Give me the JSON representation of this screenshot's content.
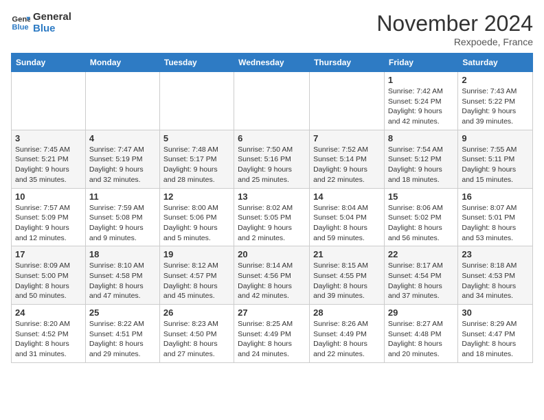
{
  "logo": {
    "line1": "General",
    "line2": "Blue"
  },
  "title": "November 2024",
  "location": "Rexpoede, France",
  "days_of_week": [
    "Sunday",
    "Monday",
    "Tuesday",
    "Wednesday",
    "Thursday",
    "Friday",
    "Saturday"
  ],
  "weeks": [
    [
      {
        "day": "",
        "info": ""
      },
      {
        "day": "",
        "info": ""
      },
      {
        "day": "",
        "info": ""
      },
      {
        "day": "",
        "info": ""
      },
      {
        "day": "",
        "info": ""
      },
      {
        "day": "1",
        "info": "Sunrise: 7:42 AM\nSunset: 5:24 PM\nDaylight: 9 hours and 42 minutes."
      },
      {
        "day": "2",
        "info": "Sunrise: 7:43 AM\nSunset: 5:22 PM\nDaylight: 9 hours and 39 minutes."
      }
    ],
    [
      {
        "day": "3",
        "info": "Sunrise: 7:45 AM\nSunset: 5:21 PM\nDaylight: 9 hours and 35 minutes."
      },
      {
        "day": "4",
        "info": "Sunrise: 7:47 AM\nSunset: 5:19 PM\nDaylight: 9 hours and 32 minutes."
      },
      {
        "day": "5",
        "info": "Sunrise: 7:48 AM\nSunset: 5:17 PM\nDaylight: 9 hours and 28 minutes."
      },
      {
        "day": "6",
        "info": "Sunrise: 7:50 AM\nSunset: 5:16 PM\nDaylight: 9 hours and 25 minutes."
      },
      {
        "day": "7",
        "info": "Sunrise: 7:52 AM\nSunset: 5:14 PM\nDaylight: 9 hours and 22 minutes."
      },
      {
        "day": "8",
        "info": "Sunrise: 7:54 AM\nSunset: 5:12 PM\nDaylight: 9 hours and 18 minutes."
      },
      {
        "day": "9",
        "info": "Sunrise: 7:55 AM\nSunset: 5:11 PM\nDaylight: 9 hours and 15 minutes."
      }
    ],
    [
      {
        "day": "10",
        "info": "Sunrise: 7:57 AM\nSunset: 5:09 PM\nDaylight: 9 hours and 12 minutes."
      },
      {
        "day": "11",
        "info": "Sunrise: 7:59 AM\nSunset: 5:08 PM\nDaylight: 9 hours and 9 minutes."
      },
      {
        "day": "12",
        "info": "Sunrise: 8:00 AM\nSunset: 5:06 PM\nDaylight: 9 hours and 5 minutes."
      },
      {
        "day": "13",
        "info": "Sunrise: 8:02 AM\nSunset: 5:05 PM\nDaylight: 9 hours and 2 minutes."
      },
      {
        "day": "14",
        "info": "Sunrise: 8:04 AM\nSunset: 5:04 PM\nDaylight: 8 hours and 59 minutes."
      },
      {
        "day": "15",
        "info": "Sunrise: 8:06 AM\nSunset: 5:02 PM\nDaylight: 8 hours and 56 minutes."
      },
      {
        "day": "16",
        "info": "Sunrise: 8:07 AM\nSunset: 5:01 PM\nDaylight: 8 hours and 53 minutes."
      }
    ],
    [
      {
        "day": "17",
        "info": "Sunrise: 8:09 AM\nSunset: 5:00 PM\nDaylight: 8 hours and 50 minutes."
      },
      {
        "day": "18",
        "info": "Sunrise: 8:10 AM\nSunset: 4:58 PM\nDaylight: 8 hours and 47 minutes."
      },
      {
        "day": "19",
        "info": "Sunrise: 8:12 AM\nSunset: 4:57 PM\nDaylight: 8 hours and 45 minutes."
      },
      {
        "day": "20",
        "info": "Sunrise: 8:14 AM\nSunset: 4:56 PM\nDaylight: 8 hours and 42 minutes."
      },
      {
        "day": "21",
        "info": "Sunrise: 8:15 AM\nSunset: 4:55 PM\nDaylight: 8 hours and 39 minutes."
      },
      {
        "day": "22",
        "info": "Sunrise: 8:17 AM\nSunset: 4:54 PM\nDaylight: 8 hours and 37 minutes."
      },
      {
        "day": "23",
        "info": "Sunrise: 8:18 AM\nSunset: 4:53 PM\nDaylight: 8 hours and 34 minutes."
      }
    ],
    [
      {
        "day": "24",
        "info": "Sunrise: 8:20 AM\nSunset: 4:52 PM\nDaylight: 8 hours and 31 minutes."
      },
      {
        "day": "25",
        "info": "Sunrise: 8:22 AM\nSunset: 4:51 PM\nDaylight: 8 hours and 29 minutes."
      },
      {
        "day": "26",
        "info": "Sunrise: 8:23 AM\nSunset: 4:50 PM\nDaylight: 8 hours and 27 minutes."
      },
      {
        "day": "27",
        "info": "Sunrise: 8:25 AM\nSunset: 4:49 PM\nDaylight: 8 hours and 24 minutes."
      },
      {
        "day": "28",
        "info": "Sunrise: 8:26 AM\nSunset: 4:49 PM\nDaylight: 8 hours and 22 minutes."
      },
      {
        "day": "29",
        "info": "Sunrise: 8:27 AM\nSunset: 4:48 PM\nDaylight: 8 hours and 20 minutes."
      },
      {
        "day": "30",
        "info": "Sunrise: 8:29 AM\nSunset: 4:47 PM\nDaylight: 8 hours and 18 minutes."
      }
    ]
  ]
}
